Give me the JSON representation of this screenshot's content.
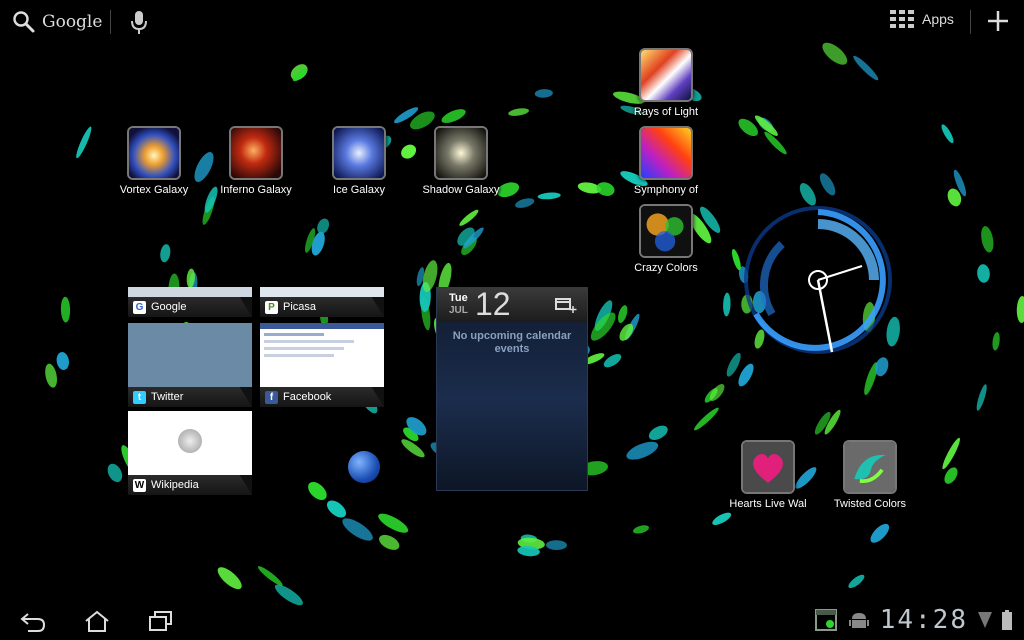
{
  "topbar": {
    "search_label": "Google",
    "apps_label": "Apps"
  },
  "shortcuts": [
    {
      "label": "Vortex Galaxy"
    },
    {
      "label": "Inferno Galaxy"
    },
    {
      "label": "Ice Galaxy"
    },
    {
      "label": "Shadow Galaxy"
    },
    {
      "label": "Rays of Light"
    },
    {
      "label": "Symphony of"
    },
    {
      "label": "Crazy Colors"
    },
    {
      "label": "Hearts Live Wal"
    },
    {
      "label": "Twisted Colors"
    }
  ],
  "bookmarks": [
    {
      "title": "Google",
      "favicon": "G"
    },
    {
      "title": "Picasa",
      "favicon": "P"
    },
    {
      "title": "Twitter",
      "favicon": "t"
    },
    {
      "title": "Facebook",
      "favicon": "f"
    },
    {
      "title": "Wikipedia",
      "favicon": "W"
    }
  ],
  "calendar": {
    "day_of_week": "Tue",
    "month": "JUL",
    "day": "12",
    "message": "No upcoming calendar events"
  },
  "systembar": {
    "time": "14:28"
  },
  "colors": {
    "accent_blue": "#33b5e5",
    "swirl_green": "#2bd82b",
    "swirl_teal": "#16c6b8"
  }
}
